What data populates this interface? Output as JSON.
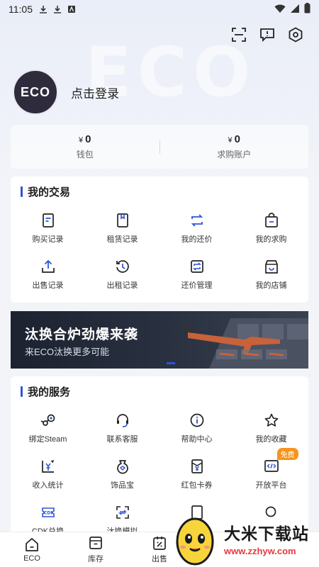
{
  "status_bar": {
    "time": "11:05"
  },
  "hero": {
    "watermark": "ECO"
  },
  "profile": {
    "avatar_text": "ECO",
    "login_label": "点击登录"
  },
  "wallet": [
    {
      "currency": "¥",
      "value": "0",
      "label": "钱包"
    },
    {
      "currency": "¥",
      "value": "0",
      "label": "求购账户"
    }
  ],
  "trade": {
    "title": "我的交易",
    "items": [
      {
        "label": "购买记录",
        "icon": "doc-icon"
      },
      {
        "label": "租赁记录",
        "icon": "bookmark-doc-icon"
      },
      {
        "label": "我的还价",
        "icon": "swap-icon"
      },
      {
        "label": "我的求购",
        "icon": "bag-icon"
      },
      {
        "label": "出售记录",
        "icon": "upload-icon"
      },
      {
        "label": "出租记录",
        "icon": "history-icon"
      },
      {
        "label": "还价管理",
        "icon": "swap-box-icon"
      },
      {
        "label": "我的店铺",
        "icon": "store-icon"
      }
    ]
  },
  "banner": {
    "title": "汰换合炉劲爆来袭",
    "subtitle": "来ECO汰换更多可能"
  },
  "services": {
    "title": "我的服务",
    "items": [
      {
        "label": "绑定Steam",
        "icon": "steam-icon"
      },
      {
        "label": "联系客服",
        "icon": "headset-icon"
      },
      {
        "label": "帮助中心",
        "icon": "info-icon"
      },
      {
        "label": "我的收藏",
        "icon": "star-icon"
      },
      {
        "label": "收入统计",
        "icon": "yen-chart-icon"
      },
      {
        "label": "饰品宝",
        "icon": "treasure-icon"
      },
      {
        "label": "红包卡券",
        "icon": "coupon-icon"
      },
      {
        "label": "开放平台",
        "icon": "code-icon",
        "badge": "免费"
      },
      {
        "label": "CDK兑换",
        "icon": "cdk-icon"
      },
      {
        "label": "汰换模拟",
        "icon": "exchange-icon"
      },
      {
        "label": "",
        "icon": "doc-icon"
      },
      {
        "label": "",
        "icon": "search-icon"
      }
    ]
  },
  "bottom_nav": [
    {
      "label": "ECO",
      "icon": "home-icon"
    },
    {
      "label": "库存",
      "icon": "inventory-icon"
    },
    {
      "label": "出售",
      "icon": "sell-icon"
    }
  ],
  "watermark_site": {
    "name": "大米下载站",
    "url": "www.zzhyw.com"
  }
}
